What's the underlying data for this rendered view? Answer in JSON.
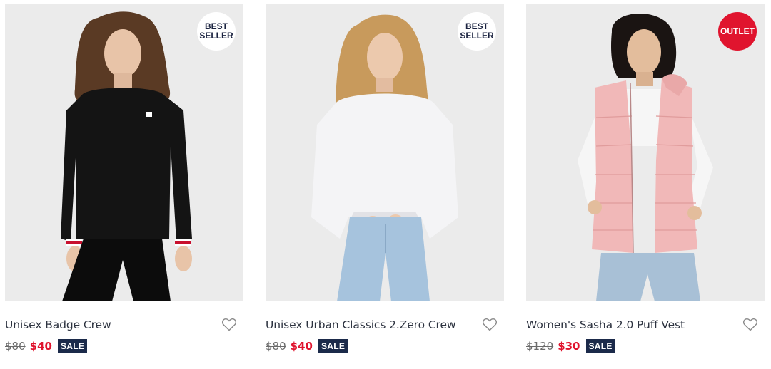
{
  "products": [
    {
      "name": "Unisex Badge Crew",
      "badge": "BEST SELLER",
      "badge_style": "white",
      "original_price": "$80",
      "sale_price": "$40",
      "sale_label": "SALE",
      "garment_color": "#141414"
    },
    {
      "name": "Unisex Urban Classics 2.Zero Crew",
      "badge": "BEST SELLER",
      "badge_style": "white",
      "original_price": "$80",
      "sale_price": "$40",
      "sale_label": "SALE",
      "garment_color": "#f4f4f6"
    },
    {
      "name": "Women's Sasha 2.0 Puff Vest",
      "badge": "OUTLET",
      "badge_style": "red",
      "original_price": "$120",
      "sale_price": "$30",
      "sale_label": "SALE",
      "garment_color": "#f1b8b8"
    }
  ],
  "colors": {
    "badge_red": "#e0142e",
    "sale_tag_navy": "#1b2a4a",
    "sale_price_red": "#e0142e",
    "image_background": "#ebebeb"
  },
  "icons": {
    "wishlist": "heart-outline-icon"
  }
}
